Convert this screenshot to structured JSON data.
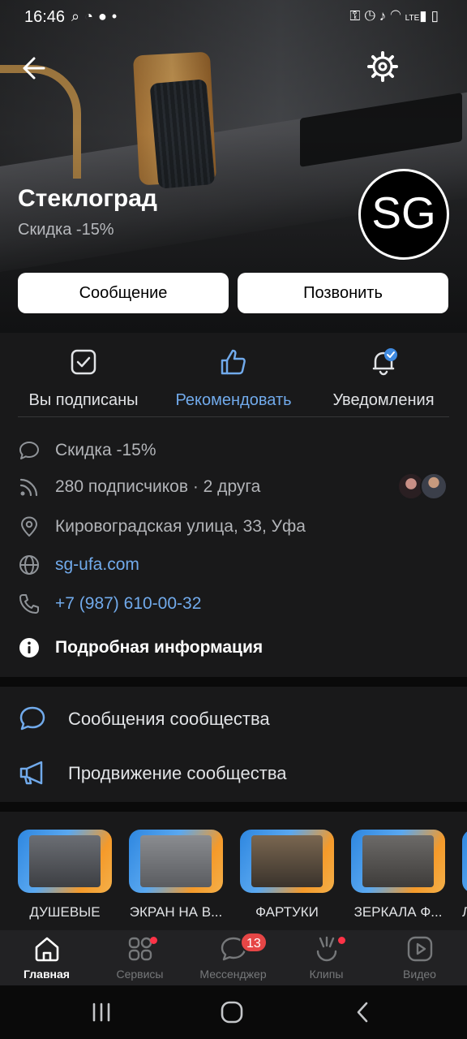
{
  "status_bar": {
    "time": "16:46",
    "left_icons": [
      "search-icon",
      "rss-icon",
      "chat-icon",
      "dot-icon"
    ],
    "right_icons": [
      "key-icon",
      "alarm-icon",
      "mute-icon",
      "wifi-icon",
      "signal-icon",
      "battery-icon"
    ],
    "network": "LTE"
  },
  "header": {
    "title": "Стеклоград",
    "status": "Скидка -15%",
    "logo_text": "SG",
    "message_button": "Сообщение",
    "call_button": "Позвонить"
  },
  "actions": [
    {
      "label": "Вы подписаны",
      "icon": "check-square-icon",
      "active": false
    },
    {
      "label": "Рекомендовать",
      "icon": "thumbs-up-icon",
      "active": true
    },
    {
      "label": "Уведомления",
      "icon": "bell-icon",
      "active": false
    }
  ],
  "info": {
    "status_text": "Скидка -15%",
    "followers": "280 подписчиков · 2 друга",
    "address": "Кировоградская улица, 33, Уфа",
    "website": "sg-ufa.com",
    "phone": "+7 (987) 610-00-32",
    "more": "Подробная информация"
  },
  "admin": {
    "messages": "Сообщения сообщества",
    "promotion": "Продвижение сообщества"
  },
  "albums": [
    {
      "name": "ДУШЕВЫЕ"
    },
    {
      "name": "ЭКРАН НА В..."
    },
    {
      "name": "ФАРТУКИ"
    },
    {
      "name": "ЗЕРКАЛА Ф..."
    },
    {
      "name": "Л"
    }
  ],
  "tabs": [
    {
      "label": "Главная",
      "icon": "home-icon",
      "active": true
    },
    {
      "label": "Сервисы",
      "icon": "services-icon",
      "dot": true
    },
    {
      "label": "Мессенджер",
      "icon": "messenger-icon",
      "badge": "13"
    },
    {
      "label": "Клипы",
      "icon": "clips-icon",
      "dot": true
    },
    {
      "label": "Видео",
      "icon": "video-icon"
    }
  ],
  "colors": {
    "accent": "#71aaeb",
    "background": "#19191a",
    "badge": "#e64646"
  }
}
